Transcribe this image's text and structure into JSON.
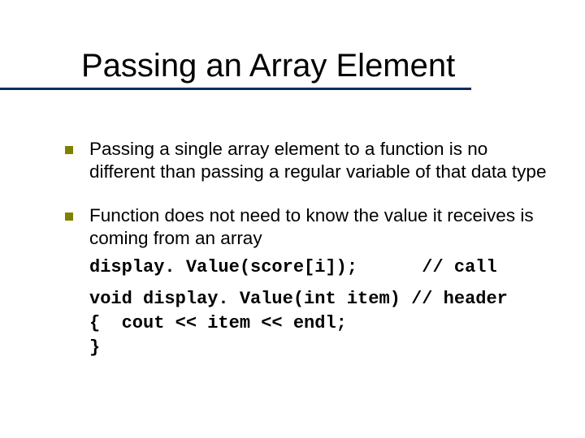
{
  "title": "Passing an Array Element",
  "bullets": [
    {
      "text": "Passing a single array element to a function is no different than passing a regular variable of that data type"
    },
    {
      "text": "Function does not need to know the value it receives is coming from an array",
      "code1": "display. Value(score[i]);      // call",
      "code2": "void display. Value(int item) // header\n{  cout << item << endl;\n}"
    }
  ]
}
